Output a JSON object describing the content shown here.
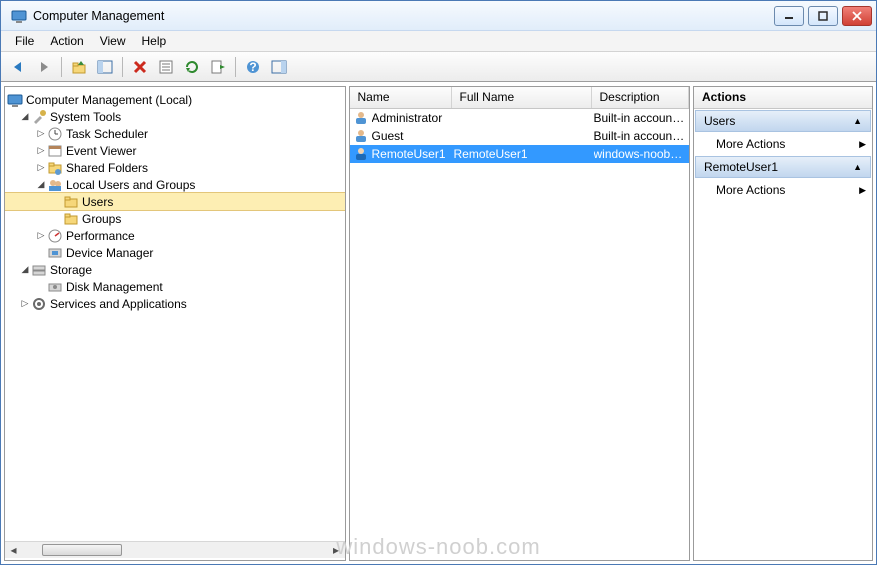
{
  "window": {
    "title": "Computer Management"
  },
  "menus": {
    "file": "File",
    "action": "Action",
    "view": "View",
    "help": "Help"
  },
  "tree": {
    "root": "Computer Management (Local)",
    "nodes": [
      {
        "label": "System Tools",
        "expanded": true
      },
      {
        "label": "Task Scheduler"
      },
      {
        "label": "Event Viewer"
      },
      {
        "label": "Shared Folders"
      },
      {
        "label": "Local Users and Groups",
        "expanded": true
      },
      {
        "label": "Users",
        "selected": true
      },
      {
        "label": "Groups"
      },
      {
        "label": "Performance"
      },
      {
        "label": "Device Manager"
      },
      {
        "label": "Storage",
        "expanded": true
      },
      {
        "label": "Disk Management"
      },
      {
        "label": "Services and Applications"
      }
    ]
  },
  "list": {
    "headers": {
      "name": "Name",
      "full": "Full Name",
      "desc": "Description"
    },
    "rows": [
      {
        "name": "Administrator",
        "full": "",
        "desc": "Built-in account for administering...",
        "selected": false
      },
      {
        "name": "Guest",
        "full": "",
        "desc": "Built-in account for guest access t...",
        "selected": false
      },
      {
        "name": "RemoteUser1",
        "full": "RemoteUser1",
        "desc": "windows-noob.com remote user",
        "selected": true
      }
    ]
  },
  "actions": {
    "title": "Actions",
    "section1": "Users",
    "more1": "More Actions",
    "section2": "RemoteUser1",
    "more2": "More Actions"
  },
  "watermark": "windows-noob.com"
}
